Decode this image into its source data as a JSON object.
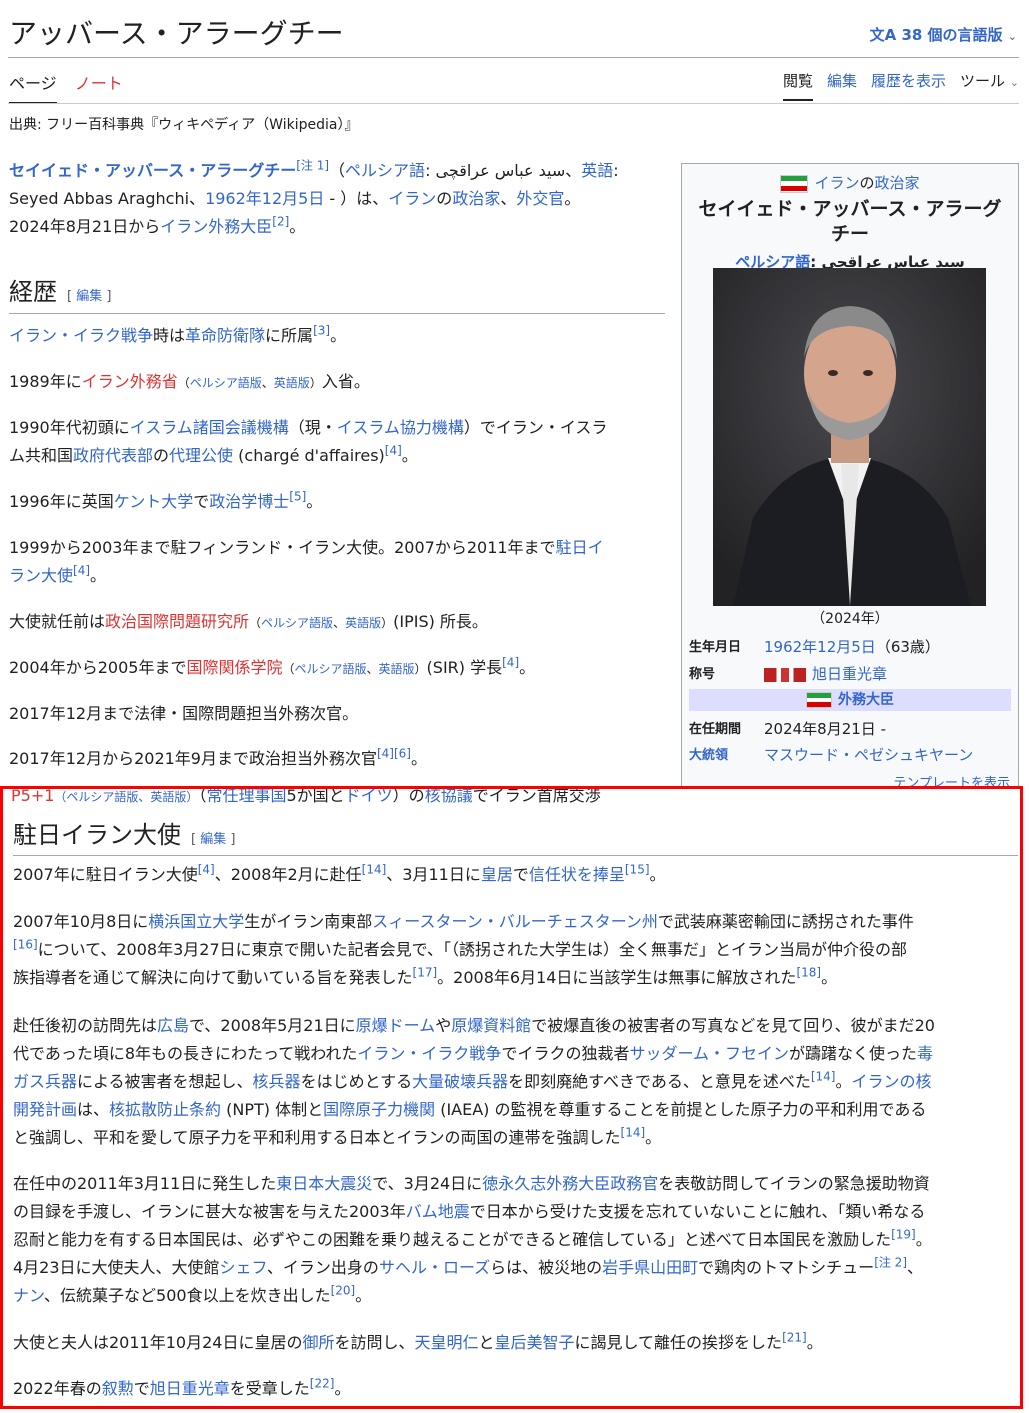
{
  "header": {
    "title": "アッバース・アラーグチー",
    "languages": "38 個の言語版",
    "lang_icon": "文A"
  },
  "tabs": {
    "page": "ページ",
    "talk": "ノート",
    "read": "閲覧",
    "edit": "編集",
    "history": "履歴を表示",
    "tools": "ツール"
  },
  "from": "出典: フリー百科事典『ウィキペディア（Wikipedia）』",
  "intro": {
    "name": "セイイェド・アッバース・アラーグチー",
    "note": "[注 1]",
    "p1": "（",
    "persian": "ペルシア語",
    "persian_text": ": سید عباس عراقچی、",
    "en": "英語",
    "en_text": ": Seyed Abbas Araghchi、",
    "birth": "1962年12月5日",
    "p2": " - ）は、",
    "iran": "イラン",
    "no": "の",
    "pol": "政治家",
    "sep": "、",
    "dip": "外交官",
    "p3": "。",
    "l2a": "2024年8月21日から",
    "fm": "イラン外務大臣",
    "ref2": "[2]",
    "end": "。"
  },
  "career": {
    "heading": "経歴",
    "edit": "編集",
    "l1": {
      "a": "イラン・イラク戦争",
      "b": "時は",
      "c": "革命防衛隊",
      "d": "に所属",
      "r": "[3]",
      "e": "。"
    },
    "l2": {
      "a": "1989年に",
      "b": "イラン外務省",
      "c": "（",
      "d": "ペルシア語版",
      "e": "、",
      "f": "英語版",
      "g": "）",
      "h": "入省。"
    },
    "l3": {
      "a": "1990年代初頭に",
      "b": "イスラム諸国会議機構",
      "c": "（現・",
      "d": "イスラム協力機構",
      "e": "）でイラン・イスラ",
      "f": "ム共和国",
      "g": "政府代表部",
      "h": "の",
      "i": "代理公使",
      "j": " (chargé d'affaires)",
      "r": "[4]",
      "k": "。"
    },
    "l4": {
      "a": "1996年に英国",
      "b": "ケント大学",
      "c": "で",
      "d": "政治学博士",
      "r": "[5]",
      "e": "。"
    },
    "l5": {
      "a": "1999から2003年まで駐フィンランド・イラン大使。2007から2011年まで",
      "b": "駐日イ",
      "c": "ラン大使",
      "r": "[4]",
      "d": "。"
    },
    "l6": {
      "a": "大使就任前は",
      "b": "政治国際問題研究所",
      "c": "（",
      "d": "ペルシア語版",
      "e": "、",
      "f": "英語版",
      "g": "）",
      "h": "(IPIS) 所長。"
    },
    "l7": {
      "a": "2004年から2005年まで",
      "b": "国際関係学院",
      "c": "（",
      "d": "ペルシア語版",
      "e": "、",
      "f": "英語版",
      "g": "）",
      "h": "(SIR) 学長",
      "r": "[4]",
      "i": "。"
    },
    "l8": "2017年12月まで法律・国際問題担当外務次官。",
    "l9": {
      "a": "2017年12月から2021年9月まで政治担当外務次官",
      "r1": "[4]",
      "r2": "[6]",
      "b": "。"
    },
    "l10": {
      "a": "P5+1",
      "b": "（ペルシア語版、英語版）",
      "c": "（",
      "d": "常任理事国",
      "e": "5か国と",
      "f": "ドイツ",
      "g": "）の",
      "h": "核協議",
      "i": "でイラン首席交渉"
    }
  },
  "infobox": {
    "above_country": "イラン",
    "above_no": "の",
    "above_role": "政治家",
    "name": "セイイェド・アッバース・アラーグチー",
    "native_label": "ペルシア語",
    "native_text": ": سید عباس عراقچی",
    "caption": "（2024年）",
    "birth_label": "生年月日",
    "birth_date": "1962年12月5日",
    "birth_age": "（63歳）",
    "title_label": "称号",
    "title_value": "旭日重光章",
    "office": "外務大臣",
    "term_label": "在任期間",
    "term_value": "2024年8月21日 -",
    "pres_label": "大統領",
    "pres_value": "マスウード・ペゼシュキヤーン",
    "template": "テンプレートを表示"
  },
  "section": {
    "heading": "駐日イラン大使",
    "edit": "編集",
    "s1": {
      "a": "2007年に駐日イラン大使",
      "r1": "[4]",
      "b": "、2008年2月に赴任",
      "r2": "[14]",
      "c": "、3月11日に",
      "d": "皇居",
      "e": "で",
      "f": "信任状を捧呈",
      "r3": "[15]",
      "g": "。"
    },
    "s2": {
      "a": "2007年10月8日に",
      "b": "横浜国立大学",
      "c": "生がイラン南東部",
      "d": "スィースターン・バルーチェスターン州",
      "e": "で武装麻薬密輸団に誘拐された事件",
      "r1": "[16]",
      "f": "について、2008年3月27日に東京で開いた記者会見で、「（誘拐された大学生は）全く無事だ」とイラン当局が仲介役の部",
      "g": "族指導者を通じて解決に向けて動いている旨を発表した",
      "r2": "[17]",
      "h": "。2008年6月14日に当該学生は無事に解放された",
      "r3": "[18]",
      "i": "。"
    },
    "s3": {
      "a": "赴任後初の訪問先は",
      "b": "広島",
      "c": "で、2008年5月21日に",
      "d": "原爆ドーム",
      "e": "や",
      "f": "原爆資料館",
      "g": "で被爆直後の被害者の写真などを見て回り、彼がまだ20",
      "h": "代であった頃に8年もの長きにわたって戦われた",
      "i": "イラン・イラク戦争",
      "j": "でイラクの独裁者",
      "k": "サッダーム・フセイン",
      "l": "が躊躇なく使った",
      "m": "毒",
      "n": "ガス兵器",
      "o": "による被害者を想起し、",
      "p": "核兵器",
      "q": "をはじめとする",
      "r": "大量破壊兵器",
      "s": "を即刻廃絶すべきである、と意見を述べた",
      "r1": "[14]",
      "t": "。",
      "u": "イランの核",
      "v": "開発計画",
      "w": "は、",
      "x": "核拡散防止条約",
      "y": " (NPT) 体制と",
      "z": "国際原子力機関",
      "aa": " (IAEA) の監視を尊重することを前提とした原子力の平和利用である",
      "ab": "と強調し、平和を愛して原子力を平和利用する日本とイランの両国の連帯を強調した",
      "r2": "[14]",
      "ac": "。"
    },
    "s4": {
      "a": "在任中の2011年3月11日に発生した",
      "b": "東日本大震災",
      "c": "で、3月24日に",
      "d": "徳永久志",
      "e": "外務大臣政務官",
      "f": "を表敬訪問してイランの緊急援助物資",
      "g": "の目録を手渡し、イランに甚大な被害を与えた2003年",
      "h": "バム地震",
      "i": "で日本から受けた支援を忘れていないことに触れ、「類い希なる",
      "j": "忍耐と能力を有する日本国民は、必ずやこの困難を乗り越えることができると確信している」と述べて日本国民を激励した",
      "r1": "[19]",
      "k": "。",
      "l": "4月23日に大使夫人、大使館",
      "m": "シェフ",
      "n": "、イラン出身の",
      "o": "サヘル・ローズ",
      "p": "らは、被災地の",
      "q": "岩手県山田町",
      "r": "で鶏肉のトマトシチュー",
      "r2": "[注 2]",
      "s": "、",
      "t": "ナン",
      "u": "、伝統菓子など500食以上を炊き出した",
      "r3": "[20]",
      "v": "。"
    },
    "s5": {
      "a": "大使と夫人は2011年10月24日に皇居の",
      "b": "御所",
      "c": "を訪問し、",
      "d": "天皇明仁",
      "e": "と",
      "f": "皇后美智子",
      "g": "に謁見して離任の挨拶をした",
      "r1": "[21]",
      "h": "。"
    },
    "s6": {
      "a": "2022年春の",
      "b": "叙勲",
      "c": "で",
      "d": "旭日重光章",
      "e": "を受章した",
      "r1": "[22]",
      "f": "。"
    }
  },
  "colors": {
    "link": "#3366cc",
    "redlink": "#d33",
    "highlight_border": "#ff0000",
    "office_bg": "#ddddff"
  }
}
